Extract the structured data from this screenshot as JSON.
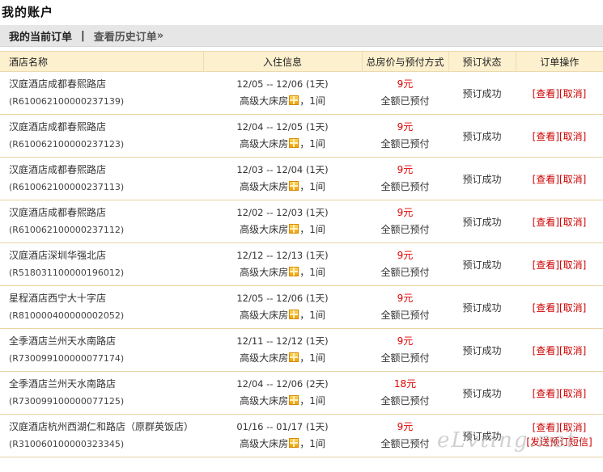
{
  "page_title": "我的账户",
  "tabs": {
    "current": "我的当前订单",
    "separator": "|",
    "history": "查看历史订单",
    "history_arrow": "»"
  },
  "columns": [
    "酒店名称",
    "入住信息",
    "总房价与预付方式",
    "预订状态",
    "订单操作"
  ],
  "orders": [
    {
      "hotel": "汉庭酒店成都春熙路店",
      "order_no": "(R610062100000237139)",
      "dates": "12/05 -- 12/06 (1天)",
      "room": "高级大床房",
      "qty": "，1间",
      "price": "9元",
      "payment": "全额已预付",
      "status": "预订成功",
      "view": "[查看]",
      "cancel": "[取消]"
    },
    {
      "hotel": "汉庭酒店成都春熙路店",
      "order_no": "(R610062100000237123)",
      "dates": "12/04 -- 12/05 (1天)",
      "room": "高级大床房",
      "qty": "，1间",
      "price": "9元",
      "payment": "全额已预付",
      "status": "预订成功",
      "view": "[查看]",
      "cancel": "[取消]"
    },
    {
      "hotel": "汉庭酒店成都春熙路店",
      "order_no": "(R610062100000237113)",
      "dates": "12/03 -- 12/04 (1天)",
      "room": "高级大床房",
      "qty": "，1间",
      "price": "9元",
      "payment": "全额已预付",
      "status": "预订成功",
      "view": "[查看]",
      "cancel": "[取消]"
    },
    {
      "hotel": "汉庭酒店成都春熙路店",
      "order_no": "(R610062100000237112)",
      "dates": "12/02 -- 12/03 (1天)",
      "room": "高级大床房",
      "qty": "，1间",
      "price": "9元",
      "payment": "全额已预付",
      "status": "预订成功",
      "view": "[查看]",
      "cancel": "[取消]"
    },
    {
      "hotel": "汉庭酒店深圳华强北店",
      "order_no": "(R518031100000196012)",
      "dates": "12/12 -- 12/13 (1天)",
      "room": "高级大床房",
      "qty": "，1间",
      "price": "9元",
      "payment": "全额已预付",
      "status": "预订成功",
      "view": "[查看]",
      "cancel": "[取消]"
    },
    {
      "hotel": "星程酒店西宁大十字店",
      "order_no": "(R810000400000002052)",
      "dates": "12/05 -- 12/06 (1天)",
      "room": "高级大床房",
      "qty": "，1间",
      "price": "9元",
      "payment": "全额已预付",
      "status": "预订成功",
      "view": "[查看]",
      "cancel": "[取消]"
    },
    {
      "hotel": "全季酒店兰州天水南路店",
      "order_no": "(R730099100000077174)",
      "dates": "12/11 -- 12/12 (1天)",
      "room": "高级大床房",
      "qty": "，1间",
      "price": "9元",
      "payment": "全额已预付",
      "status": "预订成功",
      "view": "[查看]",
      "cancel": "[取消]"
    },
    {
      "hotel": "全季酒店兰州天水南路店",
      "order_no": "(R730099100000077125)",
      "dates": "12/04 -- 12/06 (2天)",
      "room": "高级大床房",
      "qty": "，1间",
      "price": "18元",
      "payment": "全额已预付",
      "status": "预订成功",
      "view": "[查看]",
      "cancel": "[取消]"
    },
    {
      "hotel": "汉庭酒店杭州西湖仁和路店（原群英饭店）",
      "order_no": "(R310060100000323345)",
      "dates": "01/16 -- 01/17 (1天)",
      "room": "高级大床房",
      "qty": "，1间",
      "price": "9元",
      "payment": "全额已预付",
      "status": "预订成功",
      "view": "[查看]",
      "cancel": "[取消]",
      "sms": "[发送预订短信]"
    }
  ],
  "watermark": "eLvting.net",
  "colors": {
    "price": "#e00000",
    "link": "#cc0000",
    "header_bg": "#fdf0cf",
    "tab_bg": "#e6e6e6"
  }
}
